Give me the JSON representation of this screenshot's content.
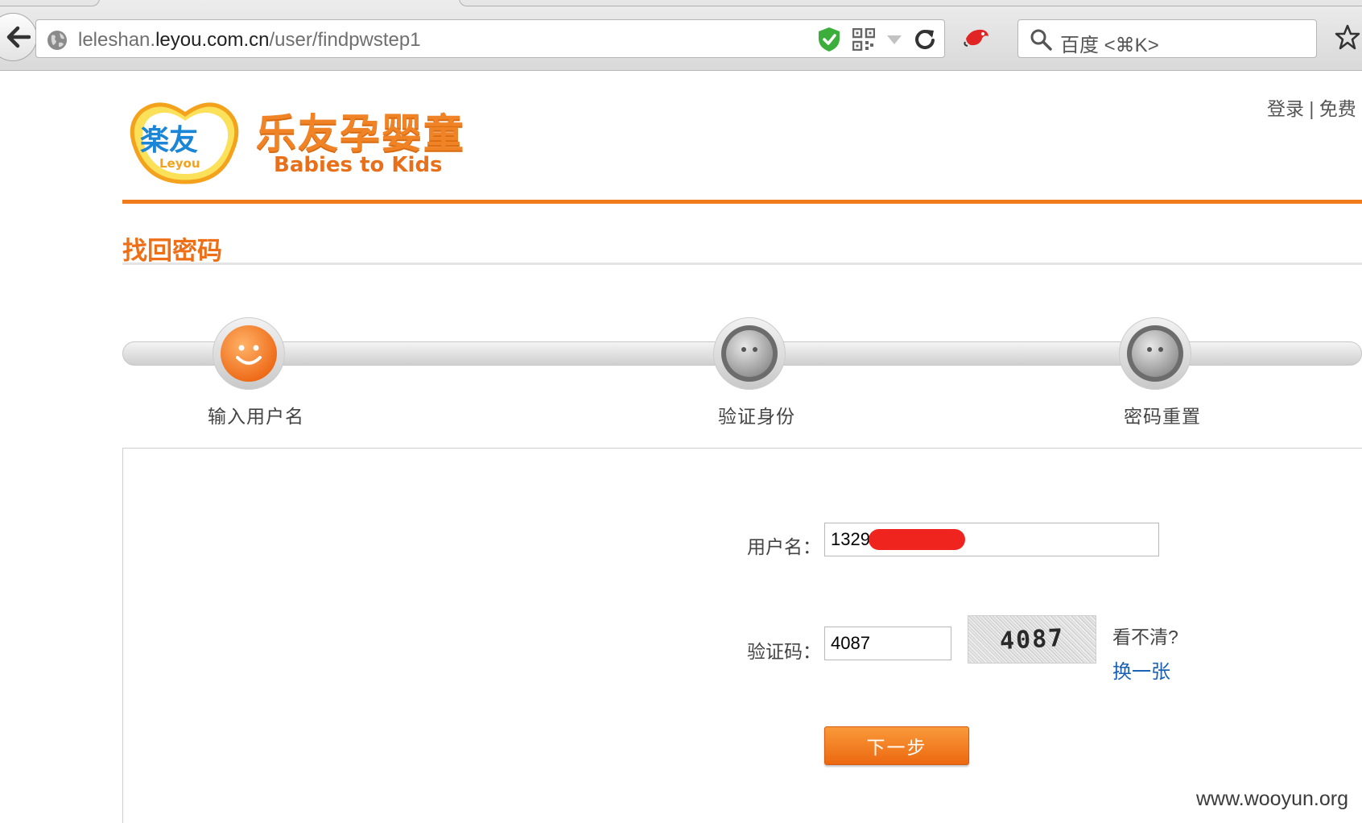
{
  "browser": {
    "url_prefix": "leleshan.",
    "url_host": "leyou.com.cn",
    "url_path": "/user/findpwstep1",
    "search_placeholder": "百度 <⌘K>"
  },
  "header": {
    "top_links": [
      "登录",
      "免费"
    ],
    "top_links_separator": " | ",
    "logo_badge": "楽友",
    "logo_badge_en": "Leyou",
    "logo_cn": "乐友孕婴童",
    "logo_en": "Babies to Kids"
  },
  "page": {
    "title": "找回密码"
  },
  "steps": [
    {
      "label": "输入用户名",
      "state": "active"
    },
    {
      "label": "验证身份",
      "state": "inactive"
    },
    {
      "label": "密码重置",
      "state": "inactive"
    }
  ],
  "form": {
    "username_label": "用户名：",
    "username_value": "1329",
    "captcha_label": "验证码：",
    "captcha_value": "4087",
    "captcha_image_text": "4087",
    "unclear_text": "看不清?",
    "refresh_link": "换一张",
    "next_button": "下一步"
  },
  "watermark": "www.wooyun.org",
  "colors": {
    "accent": "#ef7b1b",
    "title": "#ef6f17",
    "link": "#1a62b6",
    "redaction": "#f0241e"
  }
}
